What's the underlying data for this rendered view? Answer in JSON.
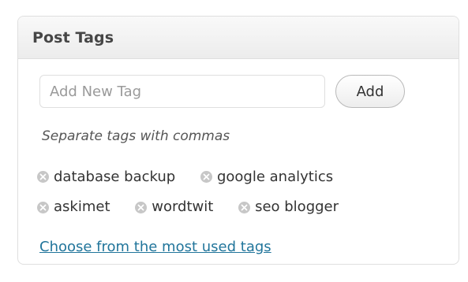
{
  "box": {
    "title": "Post Tags"
  },
  "tag_input": {
    "placeholder": "Add New Tag",
    "value": ""
  },
  "add_button": {
    "label": "Add"
  },
  "hint": {
    "text": "Separate tags with commas"
  },
  "tags": [
    {
      "label": "database backup",
      "icon": "remove-icon"
    },
    {
      "label": "google analytics",
      "icon": "remove-icon"
    },
    {
      "label": "askimet",
      "icon": "remove-icon"
    },
    {
      "label": "wordtwit",
      "icon": "remove-icon"
    },
    {
      "label": "seo blogger",
      "icon": "remove-icon"
    }
  ],
  "most_used_link": {
    "label": "Choose from the most used tags"
  },
  "colors": {
    "link": "#21759b",
    "remove_icon": "#c7c7c7",
    "header_text": "#464646",
    "border": "#dfdfdf"
  }
}
